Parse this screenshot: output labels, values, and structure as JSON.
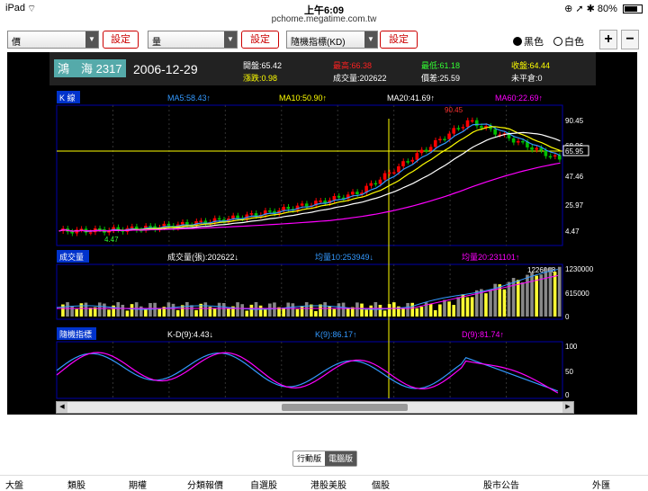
{
  "status_bar": {
    "device": "iPad",
    "time": "上午6:09",
    "url": "pchome.megatime.com.tw",
    "battery": "80%"
  },
  "toolbar": {
    "select1": "價",
    "select2": "量",
    "select3": "隨機指標(KD)",
    "set_label": "設定",
    "black": "黑色",
    "white": "白色",
    "zoom_in": "+",
    "zoom_out": "−"
  },
  "stock": {
    "name": "鴻　海 2317",
    "date": "2006-12-29",
    "open": "開盤:65.42",
    "high": "最高:66.38",
    "low": "最低:61.18",
    "close": "收盤:64.44",
    "change": "漲跌:0.98",
    "volume": "成交量:202622",
    "spread": "價差:25.59",
    "open_interest": "未平倉:0"
  },
  "kline": {
    "label": "K 線",
    "ma5": "MA5:58.43↑",
    "ma10": "MA10:50.90↑",
    "ma20": "MA20:41.69↑",
    "ma60": "MA60:22.69↑",
    "peak_label": "90.45",
    "low_label": "4.47",
    "axis": [
      "90.45",
      "68.96",
      "65.95",
      "47.46",
      "25.97",
      "4.47"
    ]
  },
  "volume_panel": {
    "label": "成交量",
    "vol": "成交量(張):202622↓",
    "ma10": "均量10:253949↓",
    "ma20": "均量20:231101↑",
    "peak": "1226068",
    "axis": [
      "1230000",
      "615000",
      "0"
    ]
  },
  "kd_panel": {
    "label": "隨機指標",
    "kd": "K-D(9):4.43↓",
    "k": "K(9):86.17↑",
    "d": "D(9):81.74↑",
    "axis": [
      "100",
      "50",
      "0"
    ]
  },
  "version": {
    "mobile": "行動版",
    "desktop": "電腦版"
  },
  "bottom_nav": [
    "大盤",
    "類股",
    "期權",
    "分類報價",
    "自選股",
    "港股美股",
    "個股",
    "股市公告",
    "外匯"
  ],
  "colors": {
    "up": "#ff0000",
    "down": "#00c000",
    "ma5": "#3399ff",
    "ma10": "#ffff00",
    "ma20": "#ffffff",
    "ma60": "#ff00ff",
    "grid": "#0000aa"
  }
}
